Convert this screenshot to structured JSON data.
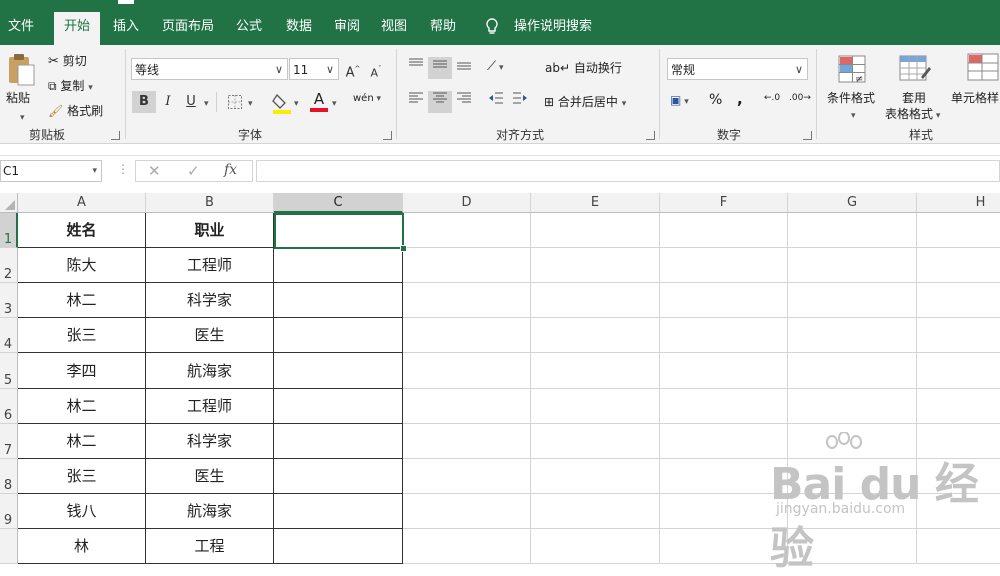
{
  "tabs": [
    "文件",
    "开始",
    "插入",
    "页面布局",
    "公式",
    "数据",
    "审阅",
    "视图",
    "帮助"
  ],
  "tell_me": "操作说明搜索",
  "clipboard": {
    "paste": "粘贴",
    "cut": "剪切",
    "copy": "复制",
    "format_painter": "格式刷",
    "group": "剪贴板"
  },
  "font": {
    "name": "等线",
    "size": "11",
    "grow": "A",
    "shrink": "A",
    "bold": "B",
    "italic": "I",
    "underline": "U",
    "font_color_letter": "A",
    "phonetic": "wén",
    "group": "字体"
  },
  "alignment": {
    "wrap_text": "自动换行",
    "merge_center": "合并后居中",
    "group": "对齐方式"
  },
  "number": {
    "format": "常规",
    "percent": "%",
    "comma": ",",
    "inc_decimal": ".0",
    "dec_decimal": ".00",
    "group": "数字"
  },
  "styles": {
    "conditional": "条件格式",
    "table_line1": "套用",
    "table_line2": "表格格式",
    "cell_styles": "单元格样",
    "group": "样式"
  },
  "formula_bar": {
    "name_box": "C1",
    "fx": "fx",
    "formula": ""
  },
  "columns": [
    "A",
    "B",
    "C",
    "D",
    "E",
    "F",
    "G",
    "H"
  ],
  "selected_column": "C",
  "rows": [
    "1",
    "2",
    "3",
    "4",
    "5",
    "6",
    "7",
    "8",
    "9"
  ],
  "selected_row": "1",
  "table": {
    "headers": [
      "姓名",
      "职业"
    ],
    "rows": [
      [
        "陈大",
        "工程师"
      ],
      [
        "林二",
        "科学家"
      ],
      [
        "张三",
        "医生"
      ],
      [
        "李四",
        "航海家"
      ],
      [
        "林二",
        "工程师"
      ],
      [
        "林二",
        "科学家"
      ],
      [
        "张三",
        "医生"
      ],
      [
        "钱八",
        "航海家"
      ],
      [
        "林",
        "工程"
      ]
    ]
  },
  "watermark": {
    "brand": "Bai du 经验",
    "url": "jingyan.baidu.com"
  },
  "colors": {
    "accent": "#217346",
    "ribbon_bg": "#f3f3f3",
    "header_bg": "#f2f2f2",
    "font_color_bar": "#e81123",
    "highlight_bar": "#ffeb00"
  }
}
